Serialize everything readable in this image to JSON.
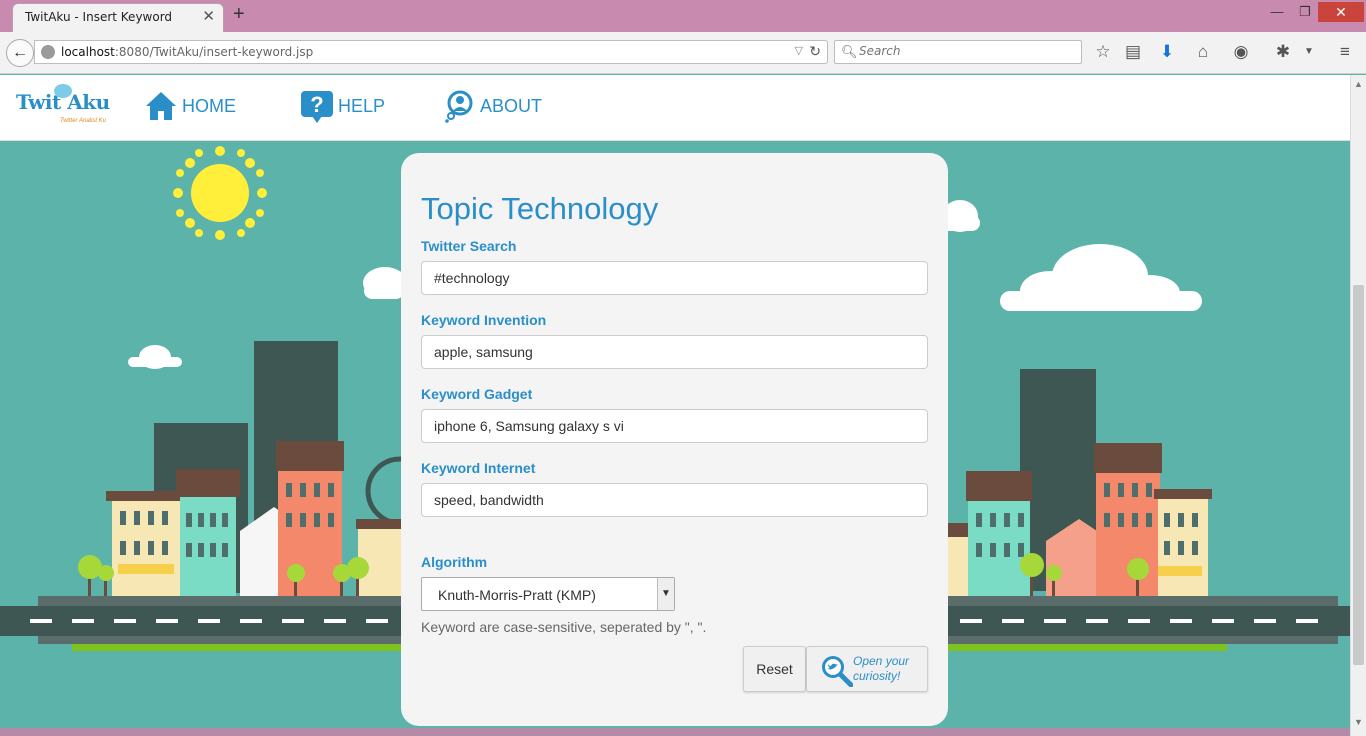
{
  "browser": {
    "tab_title": "TwitAku - Insert Keyword",
    "url_host": "localhost",
    "url_rest": ":8080/TwitAku/insert-keyword.jsp",
    "search_placeholder": "Search"
  },
  "header": {
    "logo_text": "Twit Aku",
    "logo_sub": "Twitter Analist Ku",
    "nav": [
      {
        "label": "HOME",
        "icon": "home-icon"
      },
      {
        "label": "HELP",
        "icon": "help-icon"
      },
      {
        "label": "ABOUT",
        "icon": "about-icon"
      }
    ]
  },
  "form": {
    "title": "Topic Technology",
    "fields": [
      {
        "label": "Twitter Search",
        "value": "#technology"
      },
      {
        "label": "Keyword Invention",
        "value": "apple, samsung"
      },
      {
        "label": "Keyword Gadget",
        "value": "iphone 6, Samsung galaxy s vi"
      },
      {
        "label": "Keyword Internet",
        "value": "speed, bandwidth"
      }
    ],
    "algorithm_label": "Algorithm",
    "algorithm_value": "Knuth-Morris-Pratt (KMP)",
    "help_text": "Keyword are case-sensitive, seperated by \", \".",
    "reset_label": "Reset",
    "submit_label": "Open your curiosity!"
  },
  "colors": {
    "accent": "#2a8fc9",
    "background": "#5cb3aa",
    "chrome": "#c98ab0"
  }
}
